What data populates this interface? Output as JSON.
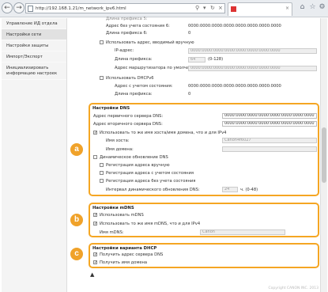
{
  "browser": {
    "url": "http://192.168.1.21/m_network_ipv6.html",
    "tab_label": ""
  },
  "sidebar": {
    "items": [
      {
        "label": "Управление ИД отдела"
      },
      {
        "label": "Настройки сети"
      },
      {
        "label": "Настройки защиты"
      },
      {
        "label": "Импорт/Экспорт"
      },
      {
        "label": "Инициализировать информацию настроек"
      }
    ]
  },
  "ipv6": {
    "top_cut_label": "Длина префикса 5:",
    "stateless_addr6_label": "Адрес без учета состояния 6:",
    "stateless_addr6_value": "0000:0000:0000:0000:0000:0000:0000:0000",
    "prefix_len6_label": "Длина префикса 6:",
    "prefix_len6_value": "0",
    "manual_addr_label": "Использовать адрес, вводимый вручную",
    "ip_addr_label": "IP-адрес:",
    "ip_addr_value": "0000:0000:0000:0000:0000:0000:0000:0000",
    "prefix_len_label": "Длина префикса:",
    "prefix_len_value": "64",
    "prefix_len_range": "(0-128)",
    "default_router_label": "Адрес маршрутизатора по умолчанию:",
    "default_router_value": "0000:0000:0000:0000:0000:0000:0000:0000",
    "dhcpv6_label": "Использовать DHCPv6",
    "stateful_addr_label": "Адрес с учетом состояния:",
    "stateful_addr_value": "0000:0000:0000:0000:0000:0000:0000:0000",
    "dhcp_prefix_len_label": "Длина префикса:",
    "dhcp_prefix_len_value": "0"
  },
  "dns": {
    "title": "Настройки DNS",
    "primary_label": "Адрес первичного сервера DNS:",
    "primary_value": "0000:0000:0000:0000:0000:0000:0000:0000",
    "secondary_label": "Адрес вторичного сервера DNS:",
    "secondary_value": "0000:0000:0000:0000:0000:0000:0000:0000",
    "same_host_label": "Использовать то же имя хоста/имя домена, что и для IPv4",
    "host_name_label": "Имя хоста:",
    "host_name_value": "Canon4f6027",
    "domain_name_label": "Имя домена:",
    "domain_name_value": "",
    "dynamic_update_label": "Динамическое обновление DNS",
    "register_manual_label": "Регистрация адреса вручную",
    "register_stateful_label": "Регистрация адреса с учетом состояния",
    "register_stateless_label": "Регистрация адреса без учета состояния",
    "interval_label": "Интервал динамического обновления DNS:",
    "interval_value": "24",
    "interval_unit": "ч. (0-48)"
  },
  "mdns": {
    "title": "Настройки mDNS",
    "use_label": "Использовать mDNS",
    "same_name_label": "Использовать то же имя mDNS, что и для IPv4",
    "name_label": "Имя mDNS:",
    "name_value": "Canon"
  },
  "dhcp_opts": {
    "title": "Настройки варианта DHCP",
    "dns_server_label": "Получить адрес сервера DNS",
    "domain_name_label": "Получить имя домена"
  },
  "callouts": {
    "a": "a",
    "b": "b",
    "c": "c"
  },
  "footer": "Copyright CANON INC. 2013",
  "colors": {
    "accent": "#f0a22a",
    "border": "#f5a623"
  }
}
